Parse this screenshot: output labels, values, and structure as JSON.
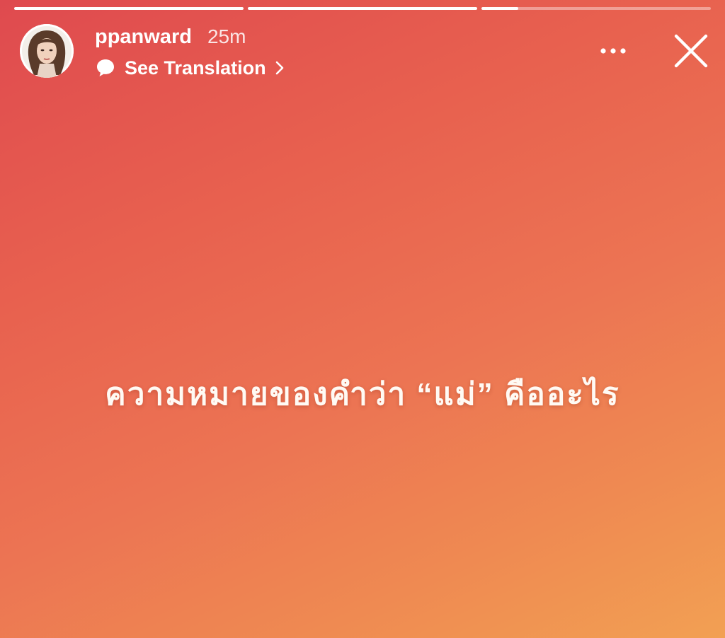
{
  "story": {
    "background_colors": [
      "#df4a4f",
      "#ec7453",
      "#f2a053"
    ],
    "progress": [
      1.0,
      1.0,
      0.16
    ]
  },
  "header": {
    "username": "ppanward",
    "time": "25m",
    "translate_label": "See Translation",
    "icons": {
      "translate": "speech-bubble-icon",
      "chevron": "chevron-right-icon",
      "more": "more-dots-icon",
      "close": "close-icon"
    }
  },
  "caption": {
    "text": "ความหมายของคำว่า “แม่” คืออะไร"
  }
}
